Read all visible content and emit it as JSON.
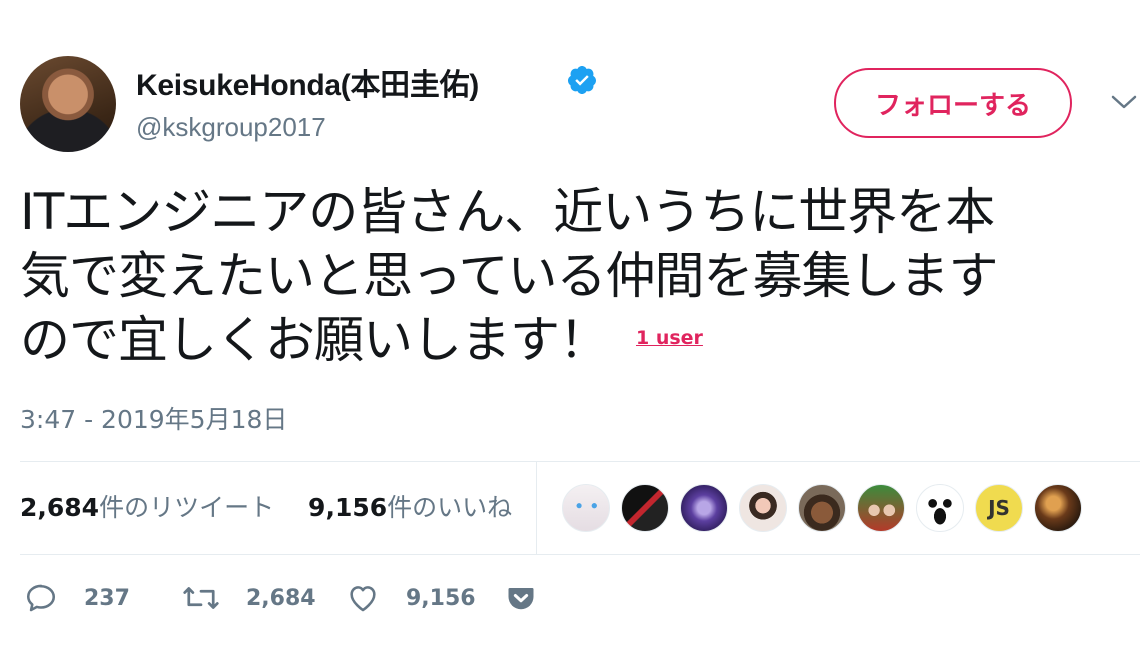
{
  "author": {
    "name": "KeisukeHonda(本田圭佑)",
    "handle": "@kskgroup2017",
    "avatar_icon": "profile-photo",
    "verified_icon": "verified-badge-icon"
  },
  "follow_button": {
    "label": "フォローする"
  },
  "menu": {
    "icon": "chevron-down-icon"
  },
  "tweet": {
    "lines": [
      "ITエンジニアの皆さん、近いうちに世界を本",
      "気で変えたいと思っている仲間を募集します",
      "ので宜しくお願いします！"
    ],
    "user_tag": "1 user"
  },
  "timestamp": "3:47 - 2019年5月18日",
  "stats": {
    "retweets_count": "2,684",
    "retweets_label": "件のリツイート",
    "likes_count": "9,156",
    "likes_label": "件のいいね"
  },
  "likers": [
    {
      "name": "liker-1"
    },
    {
      "name": "liker-2"
    },
    {
      "name": "liker-3"
    },
    {
      "name": "liker-4"
    },
    {
      "name": "liker-5"
    },
    {
      "name": "liker-6"
    },
    {
      "name": "liker-7"
    },
    {
      "name": "liker-8",
      "text": "JS"
    },
    {
      "name": "liker-9"
    }
  ],
  "actions": {
    "reply_count": "237",
    "retweet_count": "2,684",
    "like_count": "9,156"
  },
  "colors": {
    "accent": "#e0245e",
    "verified": "#1da1f2",
    "muted": "#657786",
    "text": "#14171a"
  }
}
